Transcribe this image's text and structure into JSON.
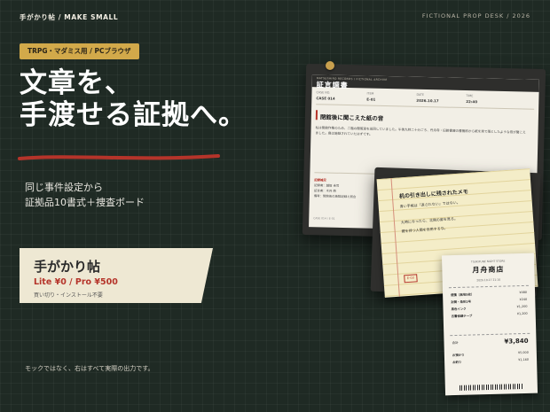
{
  "header": {
    "brand": "手がかり帖 / MAKE SMALL",
    "desk": "FICTIONAL PROP DESK / 2026"
  },
  "hero": {
    "badge": "TRPG・マダミス用 / PCブラウザ",
    "headline": [
      "文章を、",
      "手渡せる証拠へ。"
    ],
    "sub": [
      "同じ事件設定から",
      "証拠品10書式＋捜査ボード"
    ],
    "accent_color": "#b5342a"
  },
  "product_card": {
    "title": "手がかり帖",
    "price": "Lite ¥0 / Pro ¥500",
    "note": "買い切り・インストール不要"
  },
  "footer_note": "モックではなく、右はすべて実際の出力です。",
  "props": {
    "report": {
      "topline": "MATSUSHIRO RECORDS / FICTIONAL ARCHIVE",
      "title": "証言調書",
      "meta": [
        {
          "k": "CASE NO.",
          "v": "CASE 014"
        },
        {
          "k": "ITEM",
          "v": "E-01"
        },
        {
          "k": "DATE",
          "v": "2026.10.17"
        },
        {
          "k": "TIME",
          "v": "22:40"
        }
      ],
      "heading": "閉館後に聞こえた紙の音",
      "body": "私は閉館作業のため、二階の閲覧室を巡回していました。午後九時二十分ごろ、丹舟寺・旧館書庫の書棚前から紙を束で落としたような音が聞こえました。扉は施錠されていたはずです。",
      "clues_label": "記録補足",
      "clues": [
        "記録者：越智 圭司",
        "証言者：木月 萌",
        "備考：閉館後の施錠記録と照合"
      ],
      "footer": "CASE 014 / E-01"
    },
    "memo": {
      "title": "机の引き出しに残されたメモ",
      "lines": [
        "青い手帳は『返されない』ではない。",
        "九時になったら、北側の扉を見る。",
        "鍵を持つ人間を信用するな。"
      ],
      "stamp": "E-03"
    },
    "receipt": {
      "shop_en": "TSUKIFUNE NIGHT STORE",
      "shop": "月舟商店",
      "date": "2026.10.17 21:10",
      "items": [
        {
          "name": "便箋（無地5枚）",
          "price": "¥480"
        },
        {
          "name": "封筒・角形2号",
          "price": "¥240"
        },
        {
          "name": "黒色インク",
          "price": "¥1,200"
        },
        {
          "name": "古書修繕テープ",
          "price": "¥1,200"
        }
      ],
      "total_label": "合計",
      "total": "¥3,840",
      "paid_label": "お預かり",
      "paid": "¥5,000",
      "change_label": "お釣り",
      "change": "¥1,160"
    }
  }
}
